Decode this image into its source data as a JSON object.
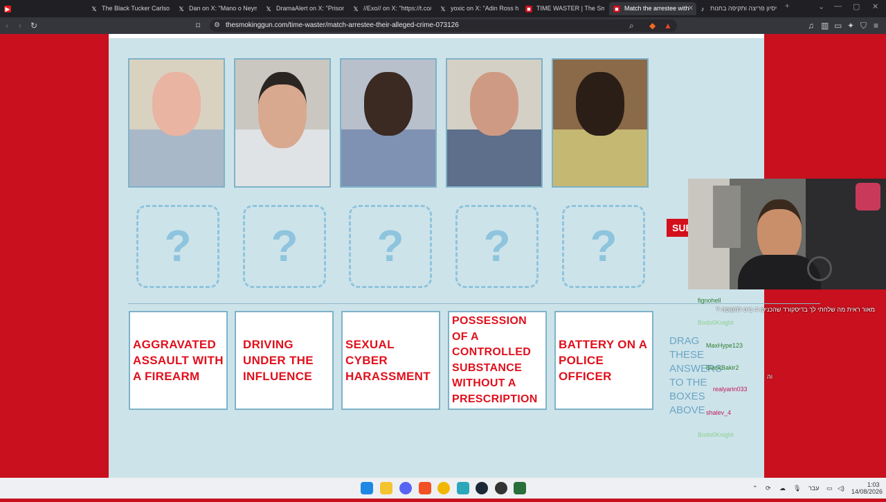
{
  "browser": {
    "tabs": [
      {
        "label": "The Black Tucker Carlson Jr",
        "icon": "x-logo-icon"
      },
      {
        "label": "Dan on X: \"Mano o Neymar",
        "icon": "x-logo-icon"
      },
      {
        "label": "DramaAlert on X: \"Prison sta",
        "icon": "x-logo-icon"
      },
      {
        "label": "//Exo// on X: \"https://t.co/jl",
        "icon": "x-logo-icon"
      },
      {
        "label": "yoxic on X: \"Adin Ross has c",
        "icon": "x-logo-icon"
      },
      {
        "label": "TIME WASTER | The Smoking",
        "icon": "smoking-gun-icon"
      },
      {
        "label": "Match the arrestee with",
        "icon": "smoking-gun-icon"
      },
      {
        "label": "ניסיון פריצה ותקיפה בחנות...",
        "icon": "tiktok-icon"
      }
    ],
    "url": "thesmokinggun.com/time-waster/match-arrestee-their-alleged-crime-073126",
    "accent": "#c8101e"
  },
  "game": {
    "mystery_mark": "?",
    "answers": [
      "AGGRAVATED ASSAULT WITH A FIREARM",
      "DRIVING UNDER THE INFLUENCE",
      "SEXUAL CYBER HARASSMENT",
      "POSSESSION OF A CONTROLLED SUBSTANCE WITHOUT A PRESCRIPTION",
      "BATTERY ON A POLICE OFFICER"
    ],
    "drag_hint": "DRAG THESE ANSWERS TO THE BOXES ABOVE",
    "submit_label": "SUB"
  },
  "stream": {
    "chat_lines": [
      {
        "user": "fignohell",
        "text": "מאור ראית מה שלחתי לך בדיסקורד שהכניסו 4 ביט לתקופה ?"
      },
      {
        "user": "Bodo0Knight",
        "text": ""
      },
      {
        "user": "MaxHype123",
        "text": ""
      },
      {
        "user": "BlackBakir2",
        "text": "וה"
      },
      {
        "user": "realyarin033",
        "text": ""
      },
      {
        "user": "shalev_4",
        "text": ""
      },
      {
        "user": "Bodo0Knight",
        "text": ""
      }
    ]
  },
  "taskbar": {
    "language": "עבר",
    "time": "1:03",
    "date": "14/08/2026"
  }
}
